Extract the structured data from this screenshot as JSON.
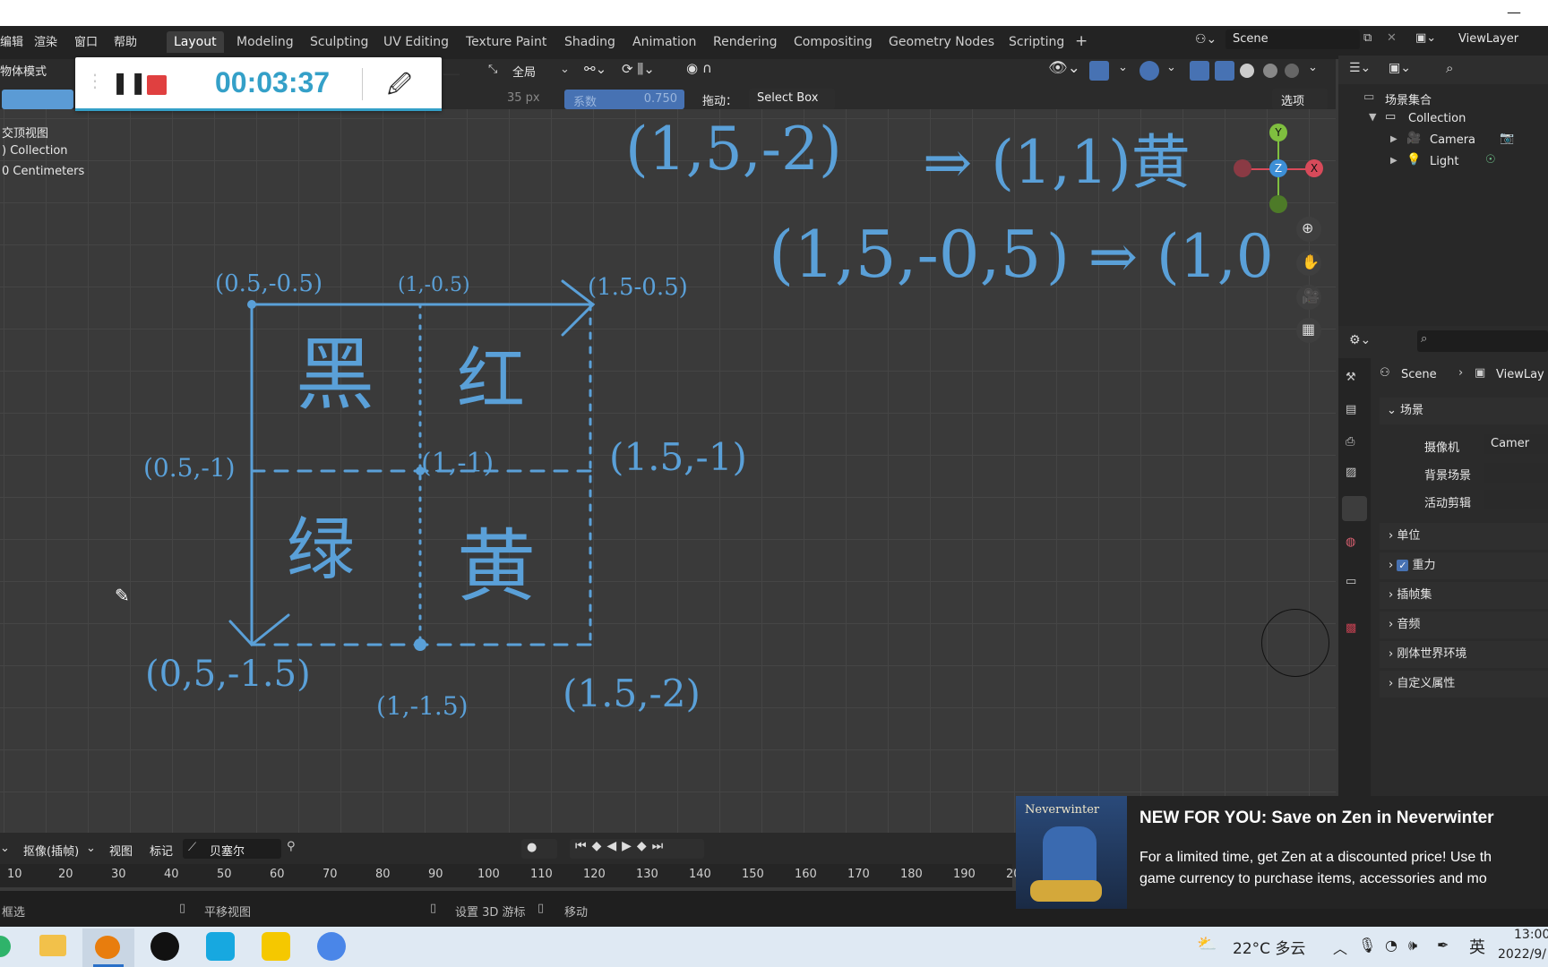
{
  "top_menu": [
    "编辑",
    "渲染",
    "窗口",
    "帮助"
  ],
  "workspaces": [
    "Layout",
    "Modeling",
    "Sculpting",
    "UV Editing",
    "Texture Paint",
    "Shading",
    "Animation",
    "Rendering",
    "Compositing",
    "Geometry Nodes",
    "Scripting"
  ],
  "add_workspace": "+",
  "scene_field": "Scene",
  "viewlayer_field": "ViewLayer",
  "mode_label": "物体模式",
  "transform_orient": "全局",
  "gp_props": {
    "radius": "35 px",
    "strength_label": "系数",
    "strength_value": "0.750",
    "drag_label": "拖动：",
    "drag_value": "Select Box",
    "options": "选项"
  },
  "recorder": {
    "time": "00:03:37",
    "progress_fraction": 1.0
  },
  "viewport_info": [
    "交顶视图",
    ") Collection",
    "0 Centimeters"
  ],
  "gizmo": {
    "y": "Y",
    "z": "Z",
    "x": "X"
  },
  "outliner": {
    "root": "场景集合",
    "collection": "Collection",
    "items": [
      "Camera",
      "Light"
    ]
  },
  "properties": {
    "breadcrumb_scene": "Scene",
    "breadcrumb_viewlayer": "ViewLay",
    "section": "场景",
    "camera_label": "摄像机",
    "camera_value": "Camer",
    "bg_label": "背景场景",
    "clip_label": "活动剪辑",
    "panels": [
      "单位",
      "重力",
      "插帧集",
      "音频",
      "刚体世界环境",
      "自定义属性"
    ]
  },
  "timeline": {
    "keying": "抠像(插帧)",
    "view": "视图",
    "marker": "标记",
    "interp": "贝塞尔"
  },
  "ruler_ticks": [
    "10",
    "20",
    "30",
    "40",
    "50",
    "60",
    "70",
    "80",
    "90",
    "100",
    "110",
    "120",
    "130",
    "140",
    "150",
    "160",
    "170",
    "180",
    "190",
    "20"
  ],
  "status": {
    "select": "框选",
    "pan": "平移视图",
    "cursor": "设置 3D 游标",
    "move": "移动"
  },
  "toast": {
    "game": "Neverwinter",
    "title": "NEW FOR YOU: Save on Zen in Neverwinter",
    "body1": "For a limited time, get Zen at a discounted price! Use th",
    "body2": "game currency to purchase items, accessories and mo"
  },
  "taskbar": {
    "weather": "22°C 多云",
    "ime": "英",
    "time": "13:00",
    "date": "2022/9/"
  },
  "annotations": {
    "p1": "(0.5,-0.5)",
    "p2": "(1,-0.5)",
    "p3": "(1.5-0.5)",
    "p4": "(0.5,-1)",
    "p5": "(1,-1)",
    "p6": "(1.5,-1)",
    "p7": "(0,5,-1.5)",
    "p8": "(1,-1.5)",
    "p9": "(1.5,-2)",
    "q_black": "黑",
    "q_red": "红",
    "q_green": "绿",
    "q_yellow": "黄",
    "eq1a": "(1,5,-2)",
    "eq1b": "⇒ (1,1)黄",
    "eq2a": "(1,5,-0,5",
    "eq2b": ") ⇒ (1,0"
  },
  "colors": {
    "annotation": "#5aa0d8",
    "accent": "#4772b3",
    "timer": "#34a0c8"
  }
}
